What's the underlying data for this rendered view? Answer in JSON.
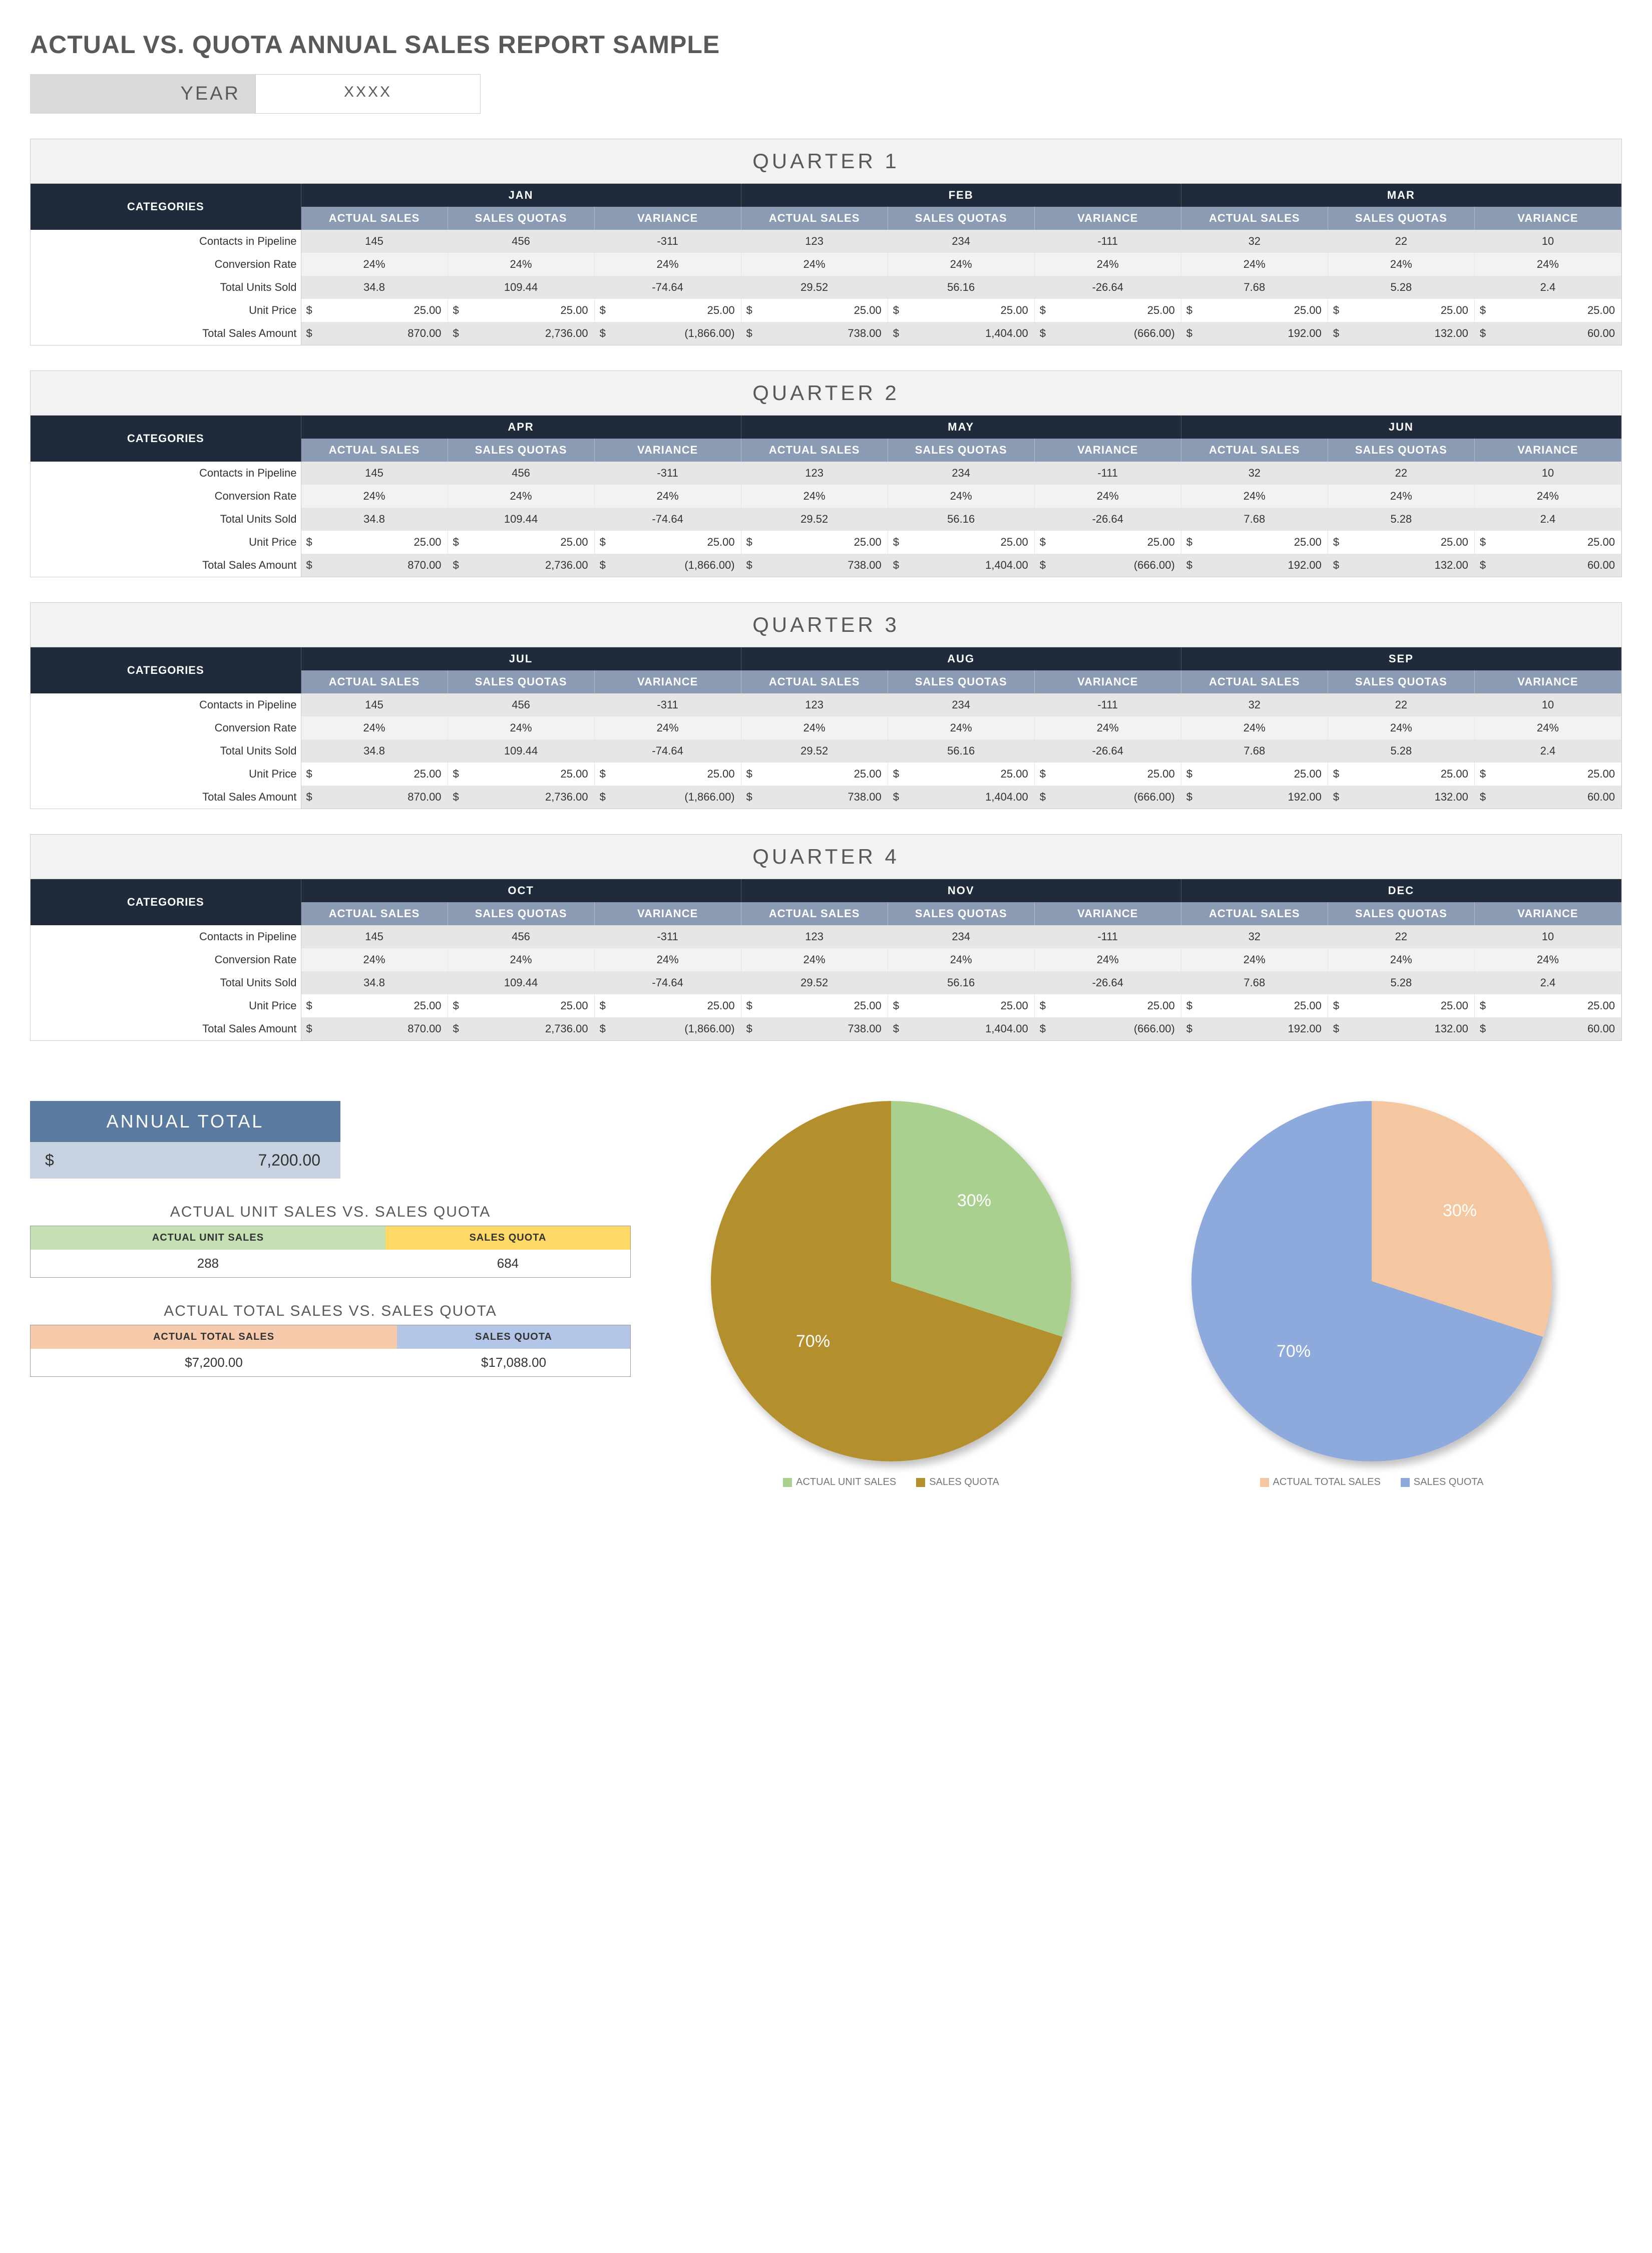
{
  "title": "ACTUAL VS. QUOTA ANNUAL SALES REPORT SAMPLE",
  "year": {
    "label": "YEAR",
    "value": "XXXX"
  },
  "sub_headers": [
    "ACTUAL SALES",
    "SALES QUOTAS",
    "VARIANCE"
  ],
  "categories_label": "CATEGORIES",
  "row_labels": [
    "Contacts in Pipeline",
    "Conversion Rate",
    "Total Units Sold",
    "Unit Price",
    "Total Sales Amount"
  ],
  "month_data": {
    "m1": {
      "r0": [
        "145",
        "456",
        "-311"
      ],
      "r1": [
        "24%",
        "24%",
        "24%"
      ],
      "r2": [
        "34.8",
        "109.44",
        "-74.64"
      ],
      "r3": [
        "25.00",
        "25.00",
        "25.00"
      ],
      "r4": [
        "870.00",
        "2,736.00",
        "(1,866.00)"
      ]
    },
    "m2": {
      "r0": [
        "123",
        "234",
        "-111"
      ],
      "r1": [
        "24%",
        "24%",
        "24%"
      ],
      "r2": [
        "29.52",
        "56.16",
        "-26.64"
      ],
      "r3": [
        "25.00",
        "25.00",
        "25.00"
      ],
      "r4": [
        "738.00",
        "1,404.00",
        "(666.00)"
      ]
    },
    "m3": {
      "r0": [
        "32",
        "22",
        "10"
      ],
      "r1": [
        "24%",
        "24%",
        "24%"
      ],
      "r2": [
        "7.68",
        "5.28",
        "2.4"
      ],
      "r3": [
        "25.00",
        "25.00",
        "25.00"
      ],
      "r4": [
        "192.00",
        "132.00",
        "60.00"
      ]
    }
  },
  "quarters": [
    {
      "title": "QUARTER 1",
      "months": [
        "JAN",
        "FEB",
        "MAR"
      ]
    },
    {
      "title": "QUARTER 2",
      "months": [
        "APR",
        "MAY",
        "JUN"
      ]
    },
    {
      "title": "QUARTER 3",
      "months": [
        "JUL",
        "AUG",
        "SEP"
      ]
    },
    {
      "title": "QUARTER 4",
      "months": [
        "OCT",
        "NOV",
        "DEC"
      ]
    }
  ],
  "annual": {
    "label": "ANNUAL TOTAL",
    "currency": "$",
    "value": "7,200.00"
  },
  "mini1": {
    "title": "ACTUAL UNIT SALES VS. SALES QUOTA",
    "h1": "ACTUAL UNIT SALES",
    "h2": "SALES QUOTA",
    "v1": "288",
    "v2": "684"
  },
  "mini2": {
    "title": "ACTUAL TOTAL SALES VS. SALES QUOTA",
    "h1": "ACTUAL TOTAL SALES",
    "h2": "SALES QUOTA",
    "v1": "$7,200.00",
    "v2": "$17,088.00"
  },
  "pie1": {
    "slice1_label": "30%",
    "slice2_label": "70%",
    "legend1": "ACTUAL UNIT SALES",
    "legend2": "SALES QUOTA",
    "color1": "#a9d08e",
    "color2": "#b38f2e"
  },
  "pie2": {
    "slice1_label": "30%",
    "slice2_label": "70%",
    "legend1": "ACTUAL TOTAL SALES",
    "legend2": "SALES QUOTA",
    "color1": "#f4c7a1",
    "color2": "#8ea9db"
  },
  "chart_data": [
    {
      "type": "pie",
      "title": "Actual Unit Sales vs. Sales Quota",
      "series": [
        {
          "name": "ACTUAL UNIT SALES",
          "value": 288,
          "percent": 30,
          "color": "#a9d08e"
        },
        {
          "name": "SALES QUOTA",
          "value": 684,
          "percent": 70,
          "color": "#b38f2e"
        }
      ]
    },
    {
      "type": "pie",
      "title": "Actual Total Sales vs. Sales Quota",
      "series": [
        {
          "name": "ACTUAL TOTAL SALES",
          "value": 7200.0,
          "percent": 30,
          "color": "#f4c7a1"
        },
        {
          "name": "SALES QUOTA",
          "value": 17088.0,
          "percent": 70,
          "color": "#8ea9db"
        }
      ]
    }
  ]
}
